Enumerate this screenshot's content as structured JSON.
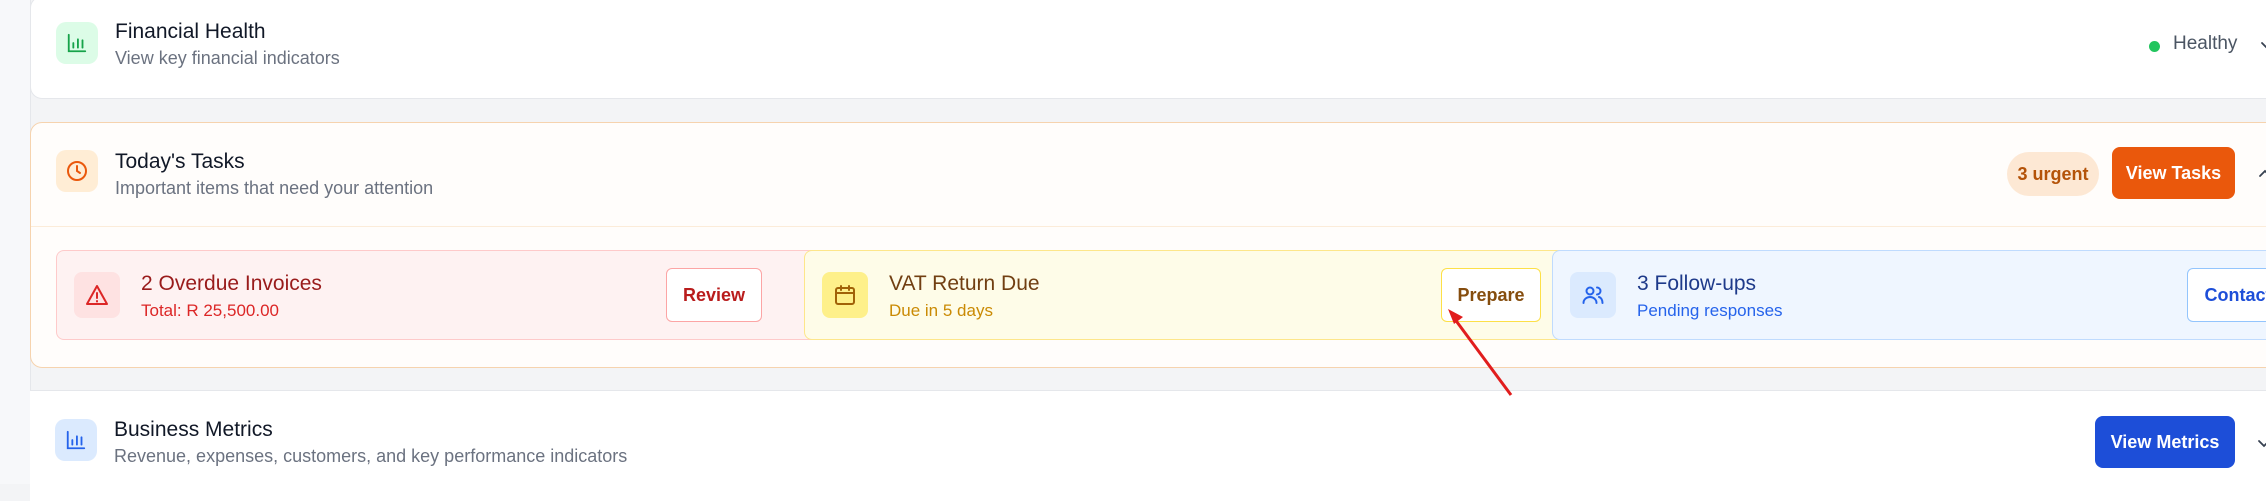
{
  "financial_health": {
    "title": "Financial Health",
    "subtitle": "View key financial indicators",
    "status": "Healthy",
    "icon": "bar-chart-icon",
    "accent": "#16a34a"
  },
  "todays_tasks": {
    "title": "Today's Tasks",
    "subtitle": "Important items that need your attention",
    "urgent_badge": "3 urgent",
    "view_button": "View Tasks",
    "icon": "clock-icon",
    "accent": "#ea580c",
    "items": [
      {
        "title": "2 Overdue Invoices",
        "subtitle": "Total: R 25,500.00",
        "action": "Review",
        "icon": "warning-triangle-icon",
        "color": "#b91c1c"
      },
      {
        "title": "VAT Return Due",
        "subtitle": "Due in 5 days",
        "action": "Prepare",
        "icon": "calendar-icon",
        "color": "#854d0e"
      },
      {
        "title": "3 Follow-ups",
        "subtitle": "Pending responses",
        "action": "Contact",
        "icon": "users-icon",
        "color": "#1e40af"
      }
    ]
  },
  "business_metrics": {
    "title": "Business Metrics",
    "subtitle": "Revenue, expenses, customers, and key performance indicators",
    "view_button": "View Metrics",
    "icon": "bar-chart-icon",
    "accent": "#2563eb"
  }
}
